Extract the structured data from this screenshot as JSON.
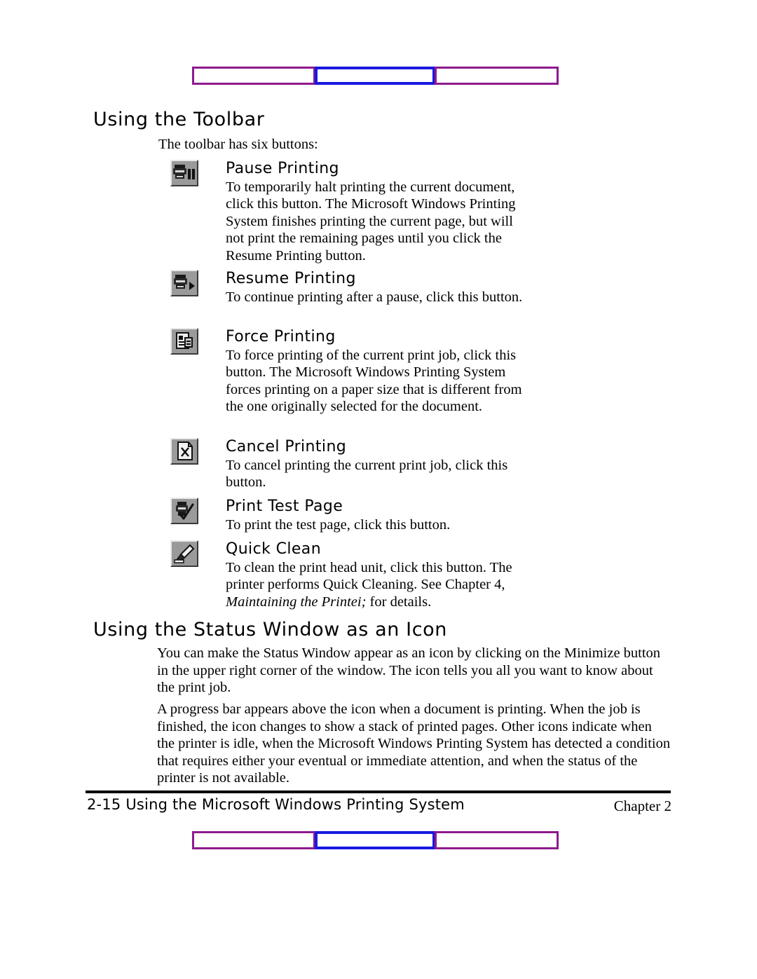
{
  "page": {
    "heading_toolbar": "Using the Toolbar",
    "intro": "The toolbar has six buttons:",
    "heading_status": "Using the Status Window as an Icon"
  },
  "toolbar_items": [
    {
      "icon": "printer-pause-icon",
      "title": "Pause Printing",
      "desc": "To temporarily halt printing the current document, click this button. The Microsoft Windows Printing System finishes printing the current page, but will not print the remaining pages until you click the Resume Printing button."
    },
    {
      "icon": "printer-play-icon",
      "title": "Resume Printing",
      "desc": "To continue printing after a pause, click this button."
    },
    {
      "icon": "document-force-icon",
      "title": "Force Printing",
      "desc": "To force printing of the current print job, click this button. The Microsoft Windows Printing System forces printing on a paper size that is different from the one originally selected for the document."
    },
    {
      "icon": "document-cancel-icon",
      "title": "Cancel Printing",
      "desc": "To cancel printing the current print job, click this button."
    },
    {
      "icon": "printer-check-icon",
      "title": "Print Test Page",
      "desc": "To print the test page, click this button."
    },
    {
      "icon": "brush-clean-icon",
      "title": "Quick Clean",
      "desc_part1": "To clean the print head unit, click this button. The printer performs Quick Cleaning. See Chapter 4, ",
      "desc_italic": "Maintaining the Printei;",
      "desc_part2": " for details."
    }
  ],
  "status_section": {
    "paragraph1": "You can make the Status Window appear as an icon by clicking on the Minimize button in the upper right corner of the window. The icon tells you all you want to know about the print job.",
    "paragraph2": "A progress bar appears above the icon when a document is printing. When the job is finished, the icon changes to show a stack of printed pages. Other icons indicate when the printer is idle, when the Microsoft Windows Printing System has detected a condition that requires either your eventual or immediate attention, and when the status of the printer is not available."
  },
  "footer": {
    "left": "2-15 Using the Microsoft Windows Printing System",
    "right": "Chapter 2"
  },
  "decor": {
    "purple": "#8e1a8e",
    "blue": "#1818e0"
  }
}
